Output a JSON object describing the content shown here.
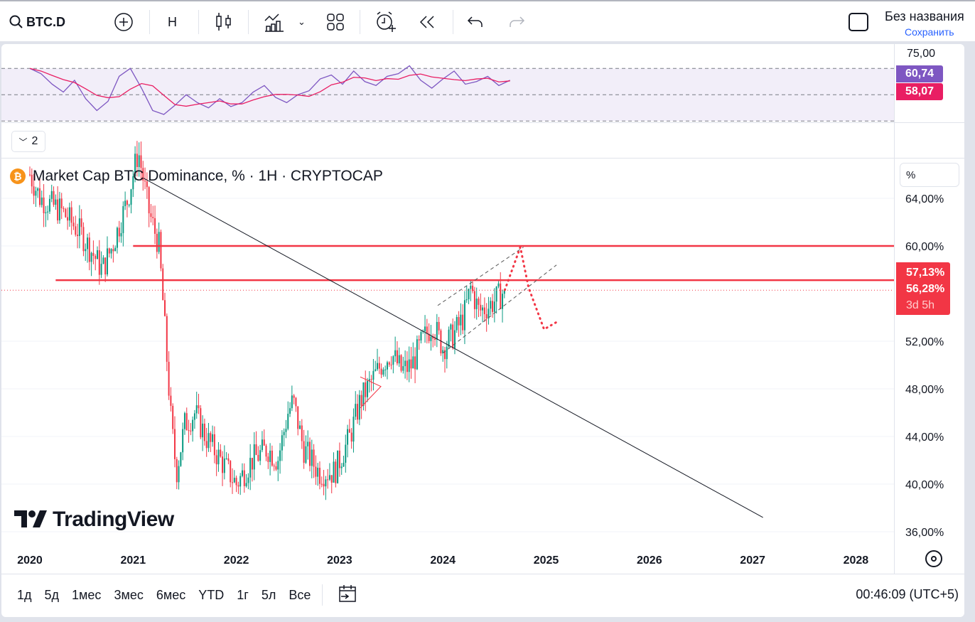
{
  "toolbar": {
    "symbol": "BTC.D",
    "interval": "H",
    "title": "Без названия",
    "save": "Сохранить"
  },
  "legend": {
    "title": "Market Cap BTC Dominance, % · 1H · CRYPTOCAP",
    "pane_toggle": "2",
    "scale_unit": "%"
  },
  "rsi": {
    "axis_label": "75,00",
    "rsi_value": "60,74",
    "ma_value": "58,07",
    "rsi_color": "#7e57c2",
    "ma_color": "#e91e63"
  },
  "price_badges": {
    "level": "57,13%",
    "last": "56,28%",
    "countdown": "3d 5h"
  },
  "watermark": "TradingView",
  "bottom": {
    "ranges": [
      "1д",
      "5д",
      "1мес",
      "3мес",
      "6мес",
      "YTD",
      "1г",
      "5л",
      "Все"
    ],
    "clock": "00:46:09 (UTC+5)"
  },
  "chart_data": {
    "type": "candlestick",
    "title": "Market Cap BTC Dominance, %",
    "ylabel": "%",
    "ylim": [
      34.5,
      66.5
    ],
    "yticks": [
      "64,00%",
      "60,00%",
      "52,00%",
      "48,00%",
      "44,00%",
      "40,00%",
      "36,00%"
    ],
    "ytick_values": [
      64,
      60,
      52,
      48,
      44,
      40,
      36
    ],
    "xticks": [
      "2020",
      "2021",
      "2022",
      "2023",
      "2024",
      "2025",
      "2026",
      "2027",
      "2028"
    ],
    "xlim": [
      2019.85,
      2028.5
    ],
    "close_path": [
      [
        2020.0,
        66
      ],
      [
        2020.1,
        64
      ],
      [
        2020.3,
        63
      ],
      [
        2020.5,
        61
      ],
      [
        2020.7,
        58
      ],
      [
        2020.8,
        60
      ],
      [
        2020.95,
        64
      ],
      [
        2021.05,
        68
      ],
      [
        2021.15,
        63
      ],
      [
        2021.25,
        60
      ],
      [
        2021.3,
        54
      ],
      [
        2021.37,
        45
      ],
      [
        2021.42,
        41
      ],
      [
        2021.5,
        45
      ],
      [
        2021.6,
        46
      ],
      [
        2021.7,
        44
      ],
      [
        2021.85,
        42
      ],
      [
        2022.0,
        40
      ],
      [
        2022.15,
        42
      ],
      [
        2022.3,
        43
      ],
      [
        2022.4,
        42
      ],
      [
        2022.5,
        46
      ],
      [
        2022.55,
        47
      ],
      [
        2022.65,
        43
      ],
      [
        2022.8,
        41
      ],
      [
        2022.95,
        41
      ],
      [
        2023.0,
        42
      ],
      [
        2023.1,
        44
      ],
      [
        2023.2,
        47
      ],
      [
        2023.3,
        48.5
      ],
      [
        2023.4,
        50
      ],
      [
        2023.5,
        51
      ],
      [
        2023.6,
        49.5
      ],
      [
        2023.7,
        50
      ],
      [
        2023.8,
        52
      ],
      [
        2023.9,
        53.5
      ],
      [
        2024.0,
        51.5
      ],
      [
        2024.1,
        52.5
      ],
      [
        2024.2,
        54
      ],
      [
        2024.27,
        56.5
      ],
      [
        2024.35,
        54.5
      ],
      [
        2024.45,
        55
      ],
      [
        2024.55,
        55.8
      ],
      [
        2024.6,
        56.28
      ]
    ],
    "last": 56.28,
    "levels": [
      {
        "value": 60,
        "from": 2021.0
      },
      {
        "value": 57.13,
        "from": 2020.25
      }
    ],
    "trendline": [
      [
        2021.1,
        65.7
      ],
      [
        2027.1,
        37.2
      ]
    ],
    "rsi_series": [
      70,
      66,
      58,
      52,
      61,
      47,
      38,
      45,
      64,
      70,
      55,
      38,
      35,
      42,
      50,
      44,
      40,
      47,
      41,
      44,
      52,
      57,
      48,
      44,
      50,
      53,
      62,
      65,
      58,
      68,
      60,
      57,
      64,
      66,
      72,
      61,
      55,
      62,
      68,
      58,
      60,
      64,
      57,
      61
    ]
  }
}
